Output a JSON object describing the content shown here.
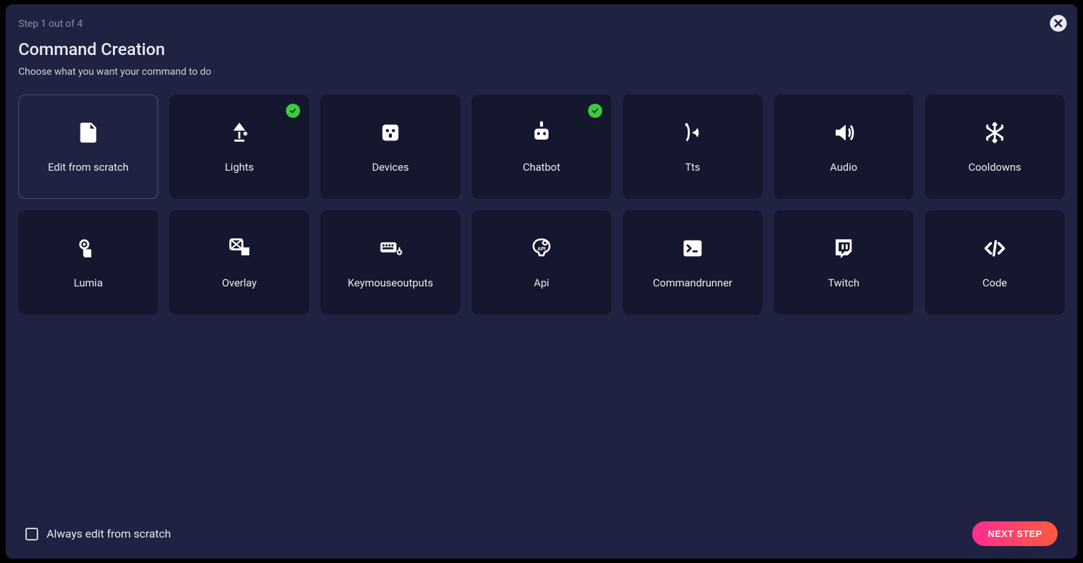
{
  "step_label": "Step 1 out of 4",
  "title": "Command Creation",
  "subtitle": "Choose what you want your command to do",
  "cards": [
    {
      "label": "Edit from scratch",
      "icon": "file",
      "selected": true,
      "checked": false
    },
    {
      "label": "Lights",
      "icon": "lamp",
      "selected": false,
      "checked": true
    },
    {
      "label": "Devices",
      "icon": "plug",
      "selected": false,
      "checked": false
    },
    {
      "label": "Chatbot",
      "icon": "robot",
      "selected": false,
      "checked": true
    },
    {
      "label": "Tts",
      "icon": "voice",
      "selected": false,
      "checked": false
    },
    {
      "label": "Audio",
      "icon": "speaker",
      "selected": false,
      "checked": false
    },
    {
      "label": "Cooldowns",
      "icon": "snowflake",
      "selected": false,
      "checked": false
    },
    {
      "label": "Lumia",
      "icon": "lumia",
      "selected": false,
      "checked": false
    },
    {
      "label": "Overlay",
      "icon": "overlay",
      "selected": false,
      "checked": false
    },
    {
      "label": "Keymouseoutputs",
      "icon": "keyboard",
      "selected": false,
      "checked": false
    },
    {
      "label": "Api",
      "icon": "api",
      "selected": false,
      "checked": false
    },
    {
      "label": "Commandrunner",
      "icon": "terminal",
      "selected": false,
      "checked": false
    },
    {
      "label": "Twitch",
      "icon": "twitch",
      "selected": false,
      "checked": false
    },
    {
      "label": "Code",
      "icon": "code",
      "selected": false,
      "checked": false
    }
  ],
  "footer": {
    "checkbox_label": "Always edit from scratch",
    "next_label": "NEXT STEP"
  }
}
